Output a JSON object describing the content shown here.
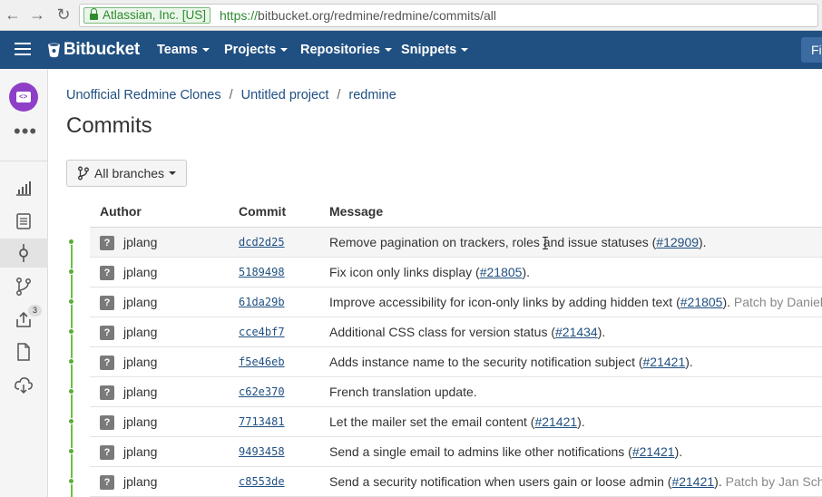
{
  "browser": {
    "ev_label": "Atlassian, Inc. [US]",
    "url_scheme": "https://",
    "url_rest": "bitbucket.org/redmine/redmine/commits/all"
  },
  "topnav": {
    "brand": "Bitbucket",
    "items": [
      "Teams",
      "Projects",
      "Repositories",
      "Snippets"
    ],
    "find_label": "Fi"
  },
  "sidebar": {
    "more": "•••",
    "pull_requests_badge": "3"
  },
  "breadcrumb": [
    "Unofficial Redmine Clones",
    "Untitled project",
    "redmine"
  ],
  "page_title": "Commits",
  "branch_filter": "All branches",
  "table": {
    "headers": {
      "author": "Author",
      "commit": "Commit",
      "message": "Message"
    },
    "rows": [
      {
        "author": "jplang",
        "hash": "dcd2d25",
        "message": "Remove pagination on trackers, roles and issue statuses (",
        "issue": "#12909",
        "suffix": ").",
        "patch": ""
      },
      {
        "author": "jplang",
        "hash": "5189498",
        "message": "Fix icon only links display (",
        "issue": "#21805",
        "suffix": ").",
        "patch": ""
      },
      {
        "author": "jplang",
        "hash": "61da29b",
        "message": "Improve accessibility for icon-only links by adding hidden text (",
        "issue": "#21805",
        "suffix": ").",
        "patch": " Patch by Daniel"
      },
      {
        "author": "jplang",
        "hash": "cce4bf7",
        "message": "Additional CSS class for version status (",
        "issue": "#21434",
        "suffix": ").",
        "patch": ""
      },
      {
        "author": "jplang",
        "hash": "f5e46eb",
        "message": "Adds instance name to the security notification subject (",
        "issue": "#21421",
        "suffix": ").",
        "patch": ""
      },
      {
        "author": "jplang",
        "hash": "c62e370",
        "message": "French translation update.",
        "issue": "",
        "suffix": "",
        "patch": ""
      },
      {
        "author": "jplang",
        "hash": "7713481",
        "message": "Let the mailer set the email content (",
        "issue": "#21421",
        "suffix": ").",
        "patch": ""
      },
      {
        "author": "jplang",
        "hash": "9493458",
        "message": "Send a single email to admins like other notifications (",
        "issue": "#21421",
        "suffix": ").",
        "patch": ""
      },
      {
        "author": "jplang",
        "hash": "c8553de",
        "message": "Send a security notification when users gain or loose admin (",
        "issue": "#21421",
        "suffix": ").",
        "patch": " Patch by Jan Sch"
      }
    ]
  },
  "avatar_placeholder": "?",
  "colors": {
    "nav_bg": "#205081",
    "link": "#205081",
    "graph": "#6cbd45",
    "repo_avatar": "#8f3fc7"
  }
}
